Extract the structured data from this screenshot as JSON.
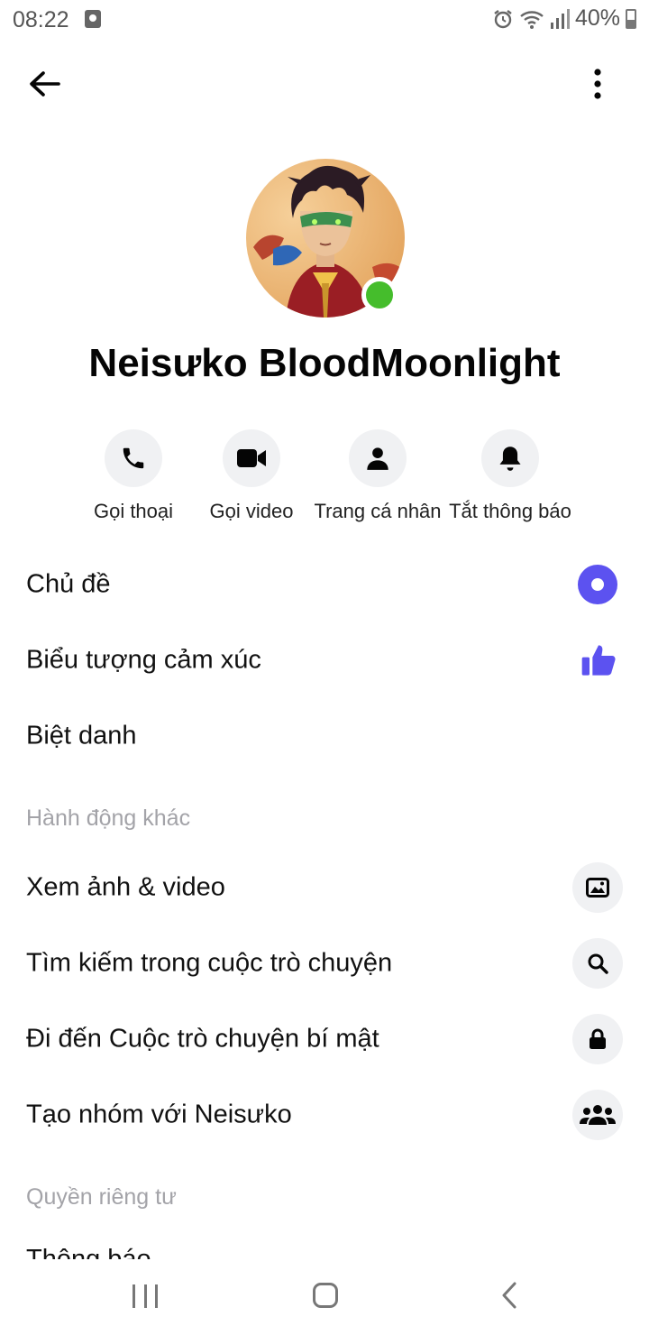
{
  "status_bar": {
    "time": "08:22",
    "battery": "40%",
    "icons": [
      "alarm-icon",
      "wifi-icon",
      "signal-icon",
      "battery-icon"
    ]
  },
  "top_bar": {
    "back_icon": "arrow-left-icon",
    "more_icon": "more-vertical-icon"
  },
  "profile": {
    "name": "Neisưko BloodMoonlight",
    "online": true,
    "online_color": "#45bd2c"
  },
  "quick_actions": [
    {
      "label": "Gọi thoại",
      "icon": "phone-icon"
    },
    {
      "label": "Gọi video",
      "icon": "video-camera-icon"
    },
    {
      "label": "Trang cá nhân",
      "icon": "person-icon"
    },
    {
      "label": "Tắt thông báo",
      "icon": "bell-icon"
    }
  ],
  "customize": {
    "theme_label": "Chủ đề",
    "theme_color": "#5c52f0",
    "emoji_label": "Biểu tượng cảm xúc",
    "emoji_icon": "thumbs-up-icon",
    "nickname_label": "Biệt danh"
  },
  "more_actions": {
    "header": "Hành động khác",
    "items": [
      {
        "label": "Xem ảnh & video",
        "icon": "image-icon"
      },
      {
        "label": "Tìm kiếm trong cuộc trò chuyện",
        "icon": "search-icon"
      },
      {
        "label": "Đi đến Cuộc trò chuyện bí mật",
        "icon": "lock-icon"
      },
      {
        "label": "Tạo nhóm với Neisưko",
        "icon": "group-icon"
      }
    ]
  },
  "privacy": {
    "header": "Quyền riêng tư",
    "first_item": "Thông báo"
  },
  "nav_bar": {
    "icons": [
      "recent-apps-icon",
      "home-icon",
      "back-icon"
    ]
  },
  "colors": {
    "accent": "#5c52f0",
    "icon_bg": "#f0f1f3",
    "section_header": "#a3a3a8"
  }
}
